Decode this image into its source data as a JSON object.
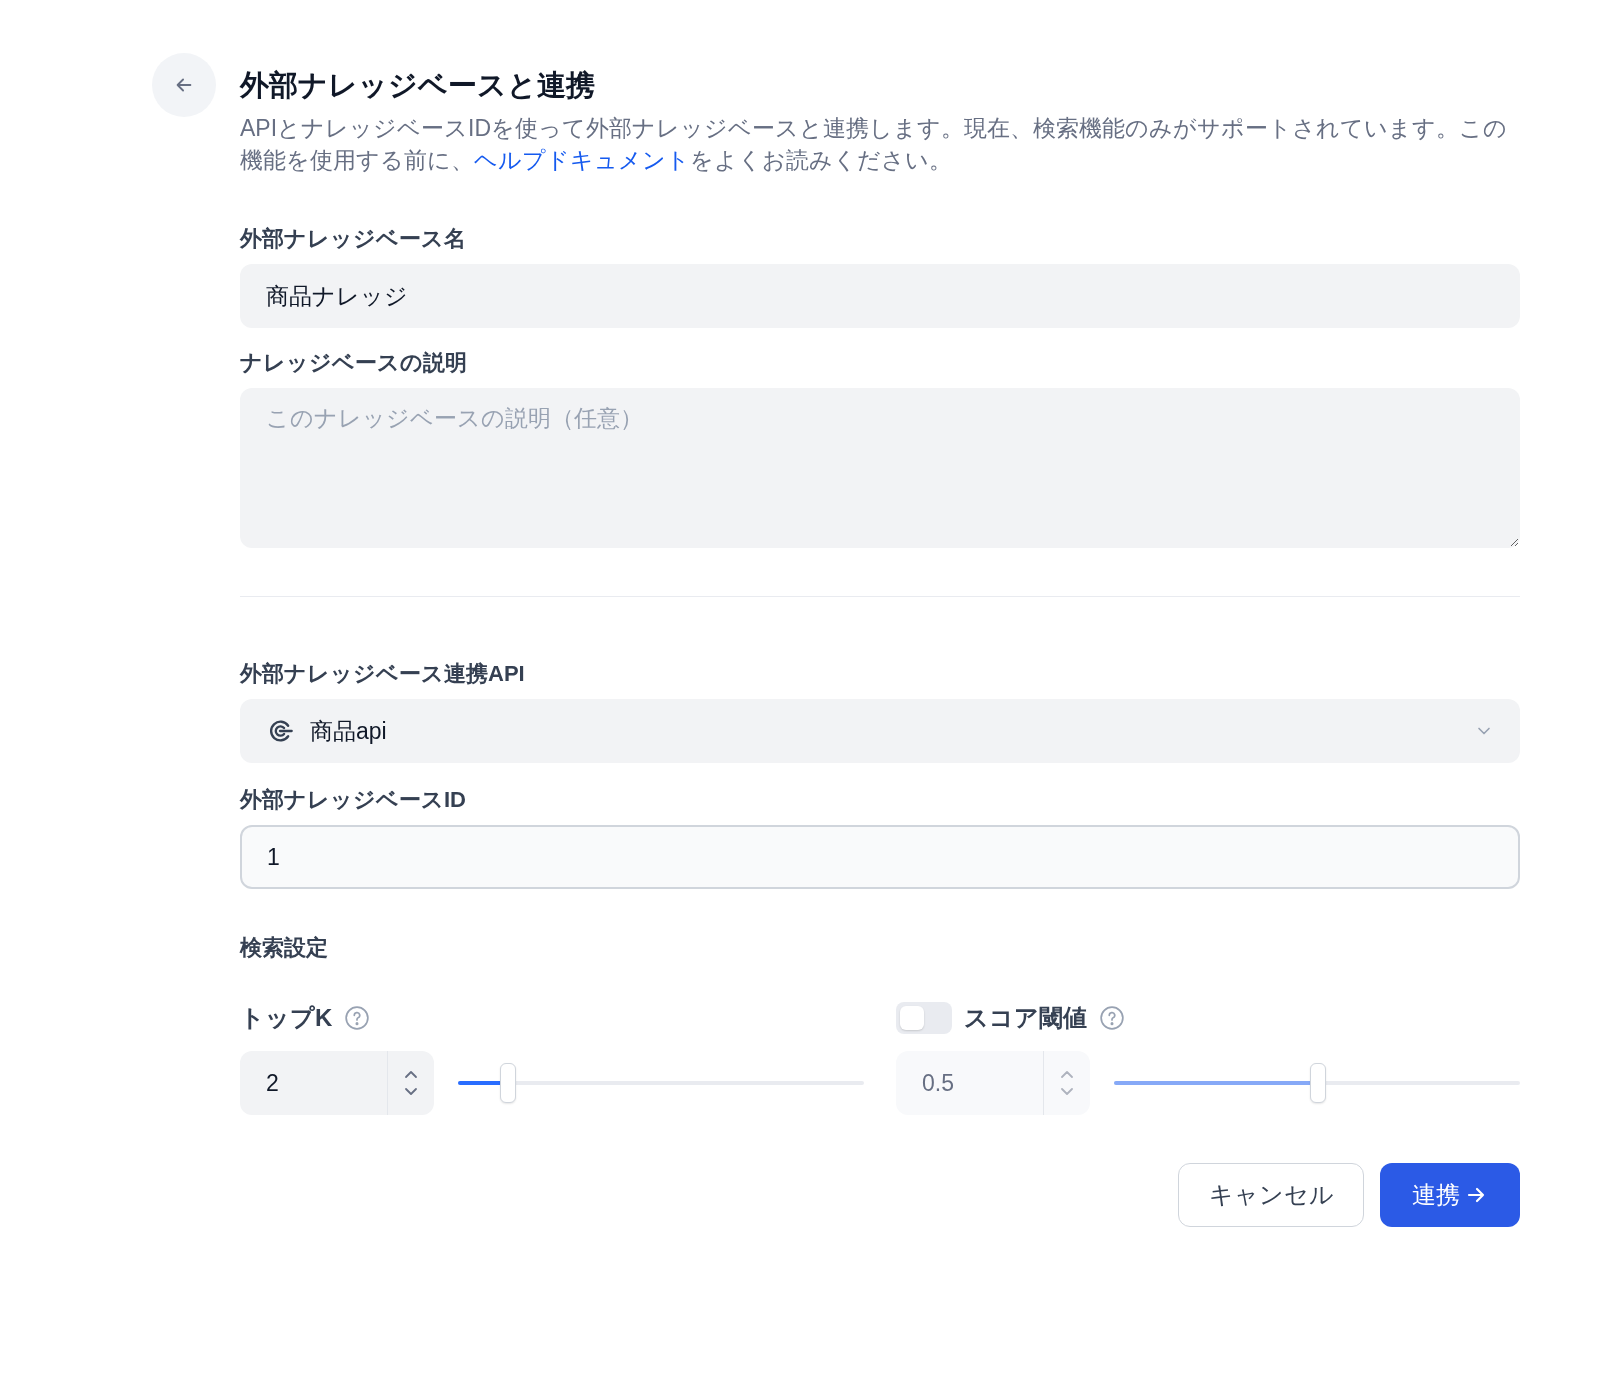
{
  "header": {
    "title": "外部ナレッジベースと連携",
    "description": {
      "before": "APIとナレッジベースIDを使って外部ナレッジベースと連携します。現在、検索機能のみがサポートされています。この機能を使用する前に、",
      "link": "ヘルプドキュメント",
      "after": "をよくお読みください。"
    }
  },
  "name_field": {
    "label": "外部ナレッジベース名",
    "value": "商品ナレッジ"
  },
  "description_field": {
    "label": "ナレッジベースの説明",
    "placeholder": "このナレッジベースの説明（任意）"
  },
  "api_field": {
    "label": "外部ナレッジベース連携API",
    "value": "商品api"
  },
  "id_field": {
    "label": "外部ナレッジベースID",
    "value": "1"
  },
  "retrieval": {
    "title": "検索設定",
    "top_k": {
      "label": "トップK",
      "value": "2",
      "level": 0.12
    },
    "score_threshold": {
      "label": "スコア閾値",
      "on": false,
      "value": "0.5",
      "level": 0.5
    }
  },
  "buttons": {
    "cancel": "キャンセル",
    "submit": "連携"
  }
}
